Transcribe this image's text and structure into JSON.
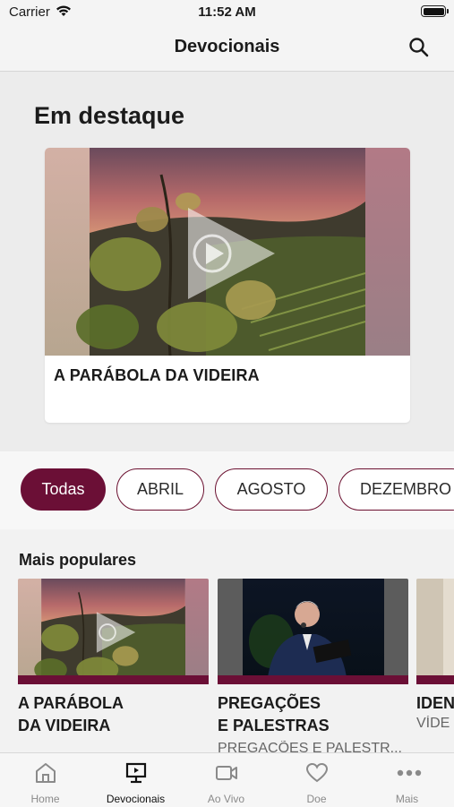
{
  "status_bar": {
    "carrier": "Carrier",
    "time": "11:52 AM"
  },
  "navbar": {
    "title": "Devocionais",
    "search_icon": "search-icon"
  },
  "featured": {
    "heading": "Em destaque",
    "card": {
      "title": "A PARÁBOLA DA VIDEIRA",
      "icon": "play-icon"
    }
  },
  "filters": {
    "items": [
      {
        "label": "Todas",
        "active": true
      },
      {
        "label": "ABRIL",
        "active": false
      },
      {
        "label": "AGOSTO",
        "active": false
      },
      {
        "label": "DEZEMBRO",
        "active": false
      }
    ]
  },
  "popular": {
    "heading": "Mais populares",
    "items": [
      {
        "title_line1": "A PARÁBOLA",
        "title_line2": "DA VIDEIRA",
        "subtitle": ""
      },
      {
        "title_line1": "PREGAÇÕES",
        "title_line2": "E PALESTRAS",
        "subtitle": "PREGAÇÕES E PALESTR..."
      },
      {
        "title_line1": "IDEN",
        "title_line2": "",
        "subtitle": "VÍDE"
      }
    ]
  },
  "tabbar": {
    "items": [
      {
        "label": "Home",
        "icon": "home-icon"
      },
      {
        "label": "Devocionais",
        "icon": "devotional-screen-icon",
        "active": true
      },
      {
        "label": "Ao Vivo",
        "icon": "video-camera-icon"
      },
      {
        "label": "Doe",
        "icon": "heart-icon"
      },
      {
        "label": "Mais",
        "icon": "more-dots-icon"
      }
    ]
  },
  "colors": {
    "accent": "#6b0f36",
    "background": "#efefef"
  }
}
